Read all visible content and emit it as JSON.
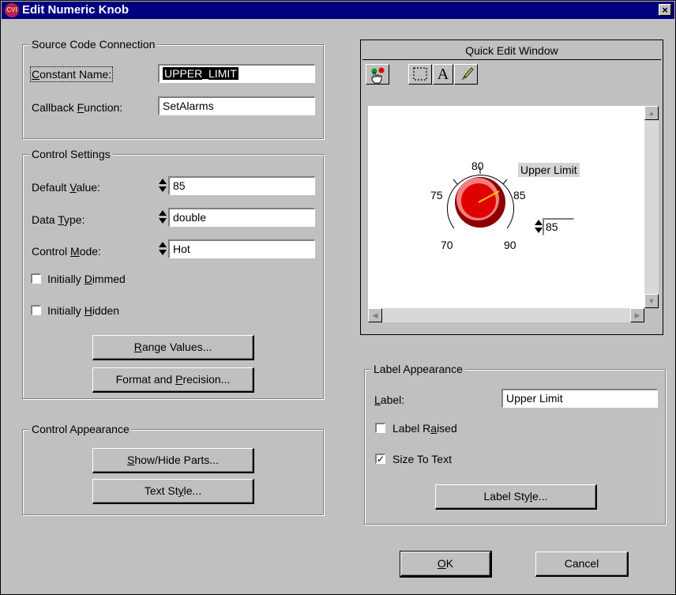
{
  "window": {
    "title": "Edit Numeric Knob",
    "icon_text": "CVI",
    "close_glyph": "×"
  },
  "source_code": {
    "title": "Source Code Connection",
    "constant_name": {
      "label_pre": "",
      "label_u": "C",
      "label_post": "onstant Name:",
      "value": "UPPER_LIMIT"
    },
    "callback": {
      "label_pre": "Callback ",
      "label_u": "F",
      "label_post": "unction:",
      "value": "SetAlarms"
    }
  },
  "control_settings": {
    "title": "Control Settings",
    "default_value": {
      "label_pre": "Default ",
      "label_u": "V",
      "label_post": "alue:",
      "value": "85"
    },
    "data_type": {
      "label_pre": "Data ",
      "label_u": "T",
      "label_post": "ype:",
      "value": "double"
    },
    "control_mode": {
      "label_pre": "Control ",
      "label_u": "M",
      "label_post": "ode:",
      "value": "Hot"
    },
    "initially_dimmed": {
      "label_pre": "Initially ",
      "label_u": "D",
      "label_post": "immed",
      "checked": false
    },
    "initially_hidden": {
      "label_pre": "Initially ",
      "label_u": "H",
      "label_post": "idden",
      "checked": false
    },
    "range_values": {
      "pre": "",
      "u": "R",
      "post": "ange Values..."
    },
    "format_precision": {
      "pre": "Format and ",
      "u": "P",
      "post": "recision..."
    }
  },
  "control_appearance": {
    "title": "Control Appearance",
    "show_hide": {
      "pre": "",
      "u": "S",
      "post": "how/Hide Parts..."
    },
    "text_style": {
      "pre": "Text St",
      "u": "y",
      "post": "le..."
    }
  },
  "quick_edit": {
    "title": "Quick Edit Window",
    "tool_text": "A",
    "knob_label": "Upper Limit",
    "knob_value": "85",
    "knob_ticks": [
      "70",
      "75",
      "80",
      "85",
      "90"
    ]
  },
  "label_appearance": {
    "title": "Label Appearance",
    "label": {
      "label_pre": "",
      "label_u": "L",
      "label_post": "abel:",
      "value": "Upper Limit"
    },
    "label_raised": {
      "label_pre": "Label R",
      "label_u": "a",
      "label_post": "ised",
      "checked": false
    },
    "size_to_text": {
      "label": "Size To Text",
      "checked": true,
      "check_glyph": "✓"
    },
    "label_style": {
      "pre": "Label Sty",
      "u": "l",
      "post": "e..."
    }
  },
  "buttons": {
    "ok": {
      "pre": "",
      "u": "O",
      "post": "K"
    },
    "cancel": {
      "label": "Cancel"
    }
  }
}
